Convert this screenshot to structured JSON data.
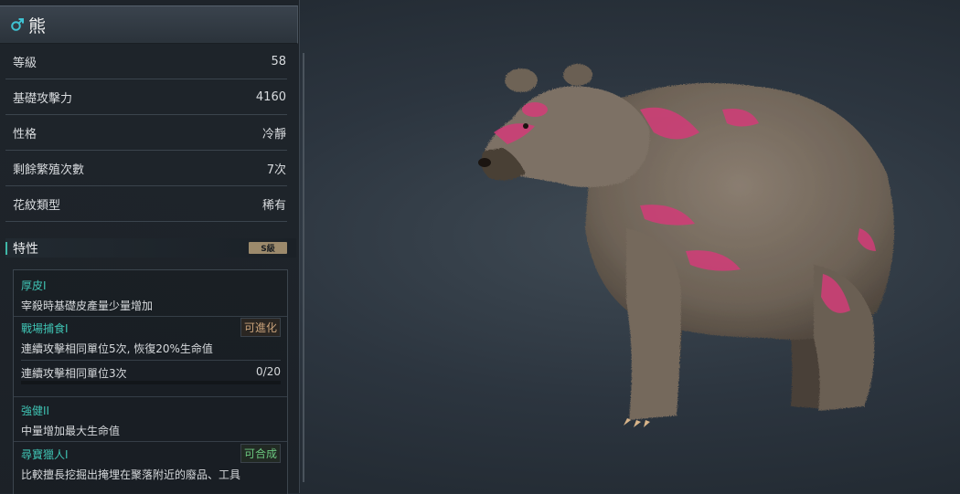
{
  "creature": {
    "name": "熊",
    "gender_icon": "male-symbol-icon"
  },
  "stats": [
    {
      "label": "等級",
      "value": "58"
    },
    {
      "label": "基礎攻擊力",
      "value": "4160"
    },
    {
      "label": "性格",
      "value": "冷靜"
    },
    {
      "label": "剩餘繁殖次數",
      "value": "7次"
    },
    {
      "label": "花紋類型",
      "value": "稀有"
    }
  ],
  "traits_section": {
    "title": "特性",
    "grade": "S級"
  },
  "traits": [
    {
      "name": "厚皮I",
      "desc": "宰殺時基礎皮產量少量增加",
      "tag": ""
    },
    {
      "name": "戰場捕食I",
      "desc": "連續攻擊相同單位5次, 恢復20%生命值",
      "tag": "可進化",
      "progress_label": "連續攻擊相同單位3次",
      "progress_text": "0/20",
      "progress_fraction": 0
    },
    {
      "name": "強健II",
      "desc": "中量增加最大生命值",
      "tag": ""
    },
    {
      "name": "尋寶獵人I",
      "desc": "比較擅長挖掘出掩埋在聚落附近的廢品、工具",
      "tag": "可合成"
    }
  ],
  "colors": {
    "accent_teal": "#3fc3b3",
    "evolve_tag": "#c9a27a",
    "combine_tag": "#6bc77f",
    "grade_badge": "#9c8a6c",
    "fur": "#7a6e62",
    "pattern": "#d23c78"
  }
}
